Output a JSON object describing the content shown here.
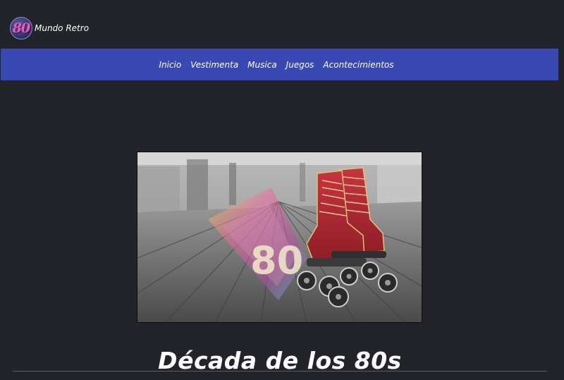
{
  "brand": {
    "logo_text": "80",
    "name": "Mundo Retro"
  },
  "nav": {
    "items": [
      {
        "label": "Inicio"
      },
      {
        "label": "Vestimenta"
      },
      {
        "label": "Musica"
      },
      {
        "label": "Juegos"
      },
      {
        "label": "Acontecimientos"
      }
    ]
  },
  "hero": {
    "image": "red-roller-skates-on-wooden-floor-with-80-logo",
    "logo_text": "80"
  },
  "main": {
    "title": "Década de los 80s"
  },
  "colors": {
    "background": "#222429",
    "navbar": "#3a48b4",
    "text": "#ffffff"
  }
}
